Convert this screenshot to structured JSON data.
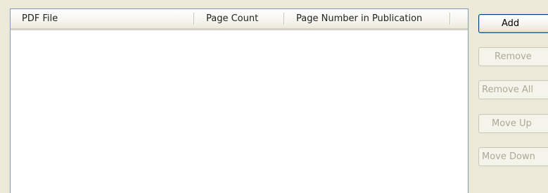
{
  "file_list": {
    "columns": [
      {
        "label": "PDF File"
      },
      {
        "label": "Page Count"
      },
      {
        "label": "Page Number in Publication"
      }
    ],
    "rows": []
  },
  "buttons": {
    "add": {
      "label": "Add",
      "enabled": true
    },
    "remove": {
      "label": "Remove",
      "enabled": false
    },
    "remove_all": {
      "label": "Remove All",
      "enabled": false
    },
    "move_up": {
      "label": "Move Up",
      "enabled": false
    },
    "move_down": {
      "label": "Move Down",
      "enabled": false
    }
  }
}
